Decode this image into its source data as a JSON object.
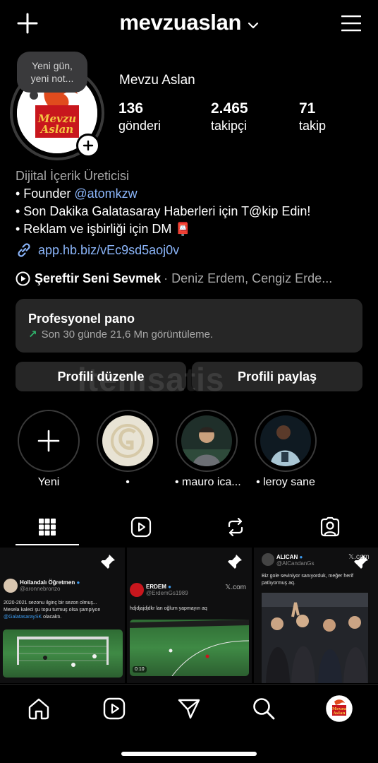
{
  "header": {
    "username": "mevzuaslan"
  },
  "note": {
    "text_line1": "Yeni gün,",
    "text_line2": "yeni not..."
  },
  "avatar": {
    "logo_line1": "Mevzu",
    "logo_line2": "Aslan"
  },
  "profile": {
    "display_name": "Mevzu Aslan",
    "stats": [
      {
        "value": "136",
        "label": "gönderi"
      },
      {
        "value": "2.465",
        "label": "takipçi"
      },
      {
        "value": "71",
        "label": "takip"
      }
    ]
  },
  "bio": {
    "category": "Dijital İçerik Üreticisi",
    "line1_prefix": "• Founder ",
    "line1_mention": "@atomkzw",
    "line2": "• Son Dakika Galatasaray Haberleri için T@kip Edin!",
    "line3": "• Reklam ve işbirliği için DM 📮",
    "link": "app.hb.biz/vEc9sd5aoj0v"
  },
  "music": {
    "title": "Şereftir Seni Sevmek",
    "artists": "· Deniz Erdem, Cengiz Erde..."
  },
  "dashboard": {
    "title": "Profesyonel pano",
    "subtitle": "Son 30 günde 21,6 Mn görüntüleme."
  },
  "buttons": {
    "edit": "Profili düzenle",
    "share": "Profili paylaş"
  },
  "watermark": "itemsatis",
  "highlights": [
    {
      "label": "Yeni"
    },
    {
      "label": "•"
    },
    {
      "label": "• mauro ica..."
    },
    {
      "label": "• leroy sane"
    }
  ],
  "posts": [
    {
      "author": "Hollandalı Öğretmen",
      "handle": "@aronnebronzo",
      "text_line1": "2020-2021 sezonu ilginç bir sezon olmuş...",
      "text_line2": "Mesela kaleci şu topu turmuş olsa şampiyon",
      "mention": "@GalatasaraySK",
      "text_line3_end": " olacaktı."
    },
    {
      "author": "ERDEM",
      "handle": "@ErdemGs1989",
      "brand": "𝕏.com",
      "text": "hdjdjajdjdkr lan oğlum yapmayın aq",
      "duration": "0:10"
    },
    {
      "author": "ALICAN",
      "handle": "@AlCandanGs",
      "brand": "𝕏.com",
      "text_line1": "Biz gole seviniyor sanıyorduk, meğer herif",
      "text_line2": "patlıyormuş aq."
    }
  ],
  "colors": {
    "background": "#000000",
    "card": "#262626",
    "link": "#8ab4f8",
    "trend_up": "#2fb36b",
    "logo_red": "#c8161d"
  }
}
